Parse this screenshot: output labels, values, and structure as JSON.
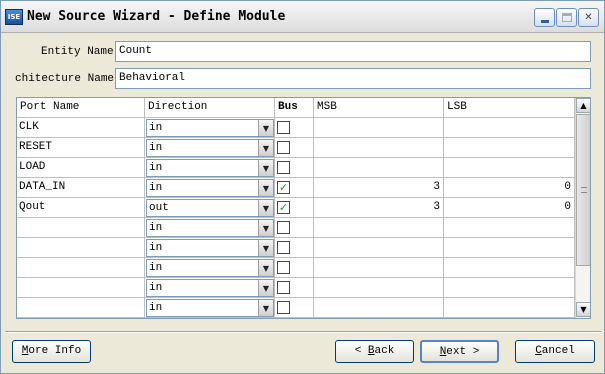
{
  "window": {
    "app_icon": "ISE",
    "title": "New Source Wizard - Define Module",
    "controls": [
      "minimize-icon",
      "maximize-icon",
      "close-icon"
    ]
  },
  "entity": {
    "label": "Entity Name",
    "value": "Count"
  },
  "architecture": {
    "label": "chitecture Name",
    "value": "Behavioral"
  },
  "grid": {
    "headers": [
      "Port Name",
      "Direction",
      "Bus",
      "MSB",
      "LSB"
    ],
    "rows": [
      {
        "port": "CLK",
        "dir": "in",
        "bus": "",
        "msb": "",
        "lsb": ""
      },
      {
        "port": "RESET",
        "dir": "in",
        "bus": "",
        "msb": "",
        "lsb": ""
      },
      {
        "port": "LOAD",
        "dir": "in",
        "bus": "",
        "msb": "",
        "lsb": ""
      },
      {
        "port": "DATA_IN",
        "dir": "in",
        "bus": "✓",
        "msb": "3",
        "lsb": "0"
      },
      {
        "port": "Qout",
        "dir": "out",
        "bus": "✓",
        "msb": "3",
        "lsb": "0"
      },
      {
        "port": "",
        "dir": "in",
        "bus": "",
        "msb": "",
        "lsb": ""
      },
      {
        "port": "",
        "dir": "in",
        "bus": "",
        "msb": "",
        "lsb": ""
      },
      {
        "port": "",
        "dir": "in",
        "bus": "",
        "msb": "",
        "lsb": ""
      },
      {
        "port": "",
        "dir": "in",
        "bus": "",
        "msb": "",
        "lsb": ""
      },
      {
        "port": "",
        "dir": "in",
        "bus": "",
        "msb": "",
        "lsb": ""
      }
    ]
  },
  "buttons": {
    "more_info": {
      "first": "M",
      "rest": "ore Info"
    },
    "back": {
      "prefix": "< ",
      "mnemonic": "B",
      "rest": "ack"
    },
    "next": {
      "mnemonic": "N",
      "rest": "ext >"
    },
    "cancel": {
      "mnemonic": "C",
      "rest": "ancel"
    }
  }
}
